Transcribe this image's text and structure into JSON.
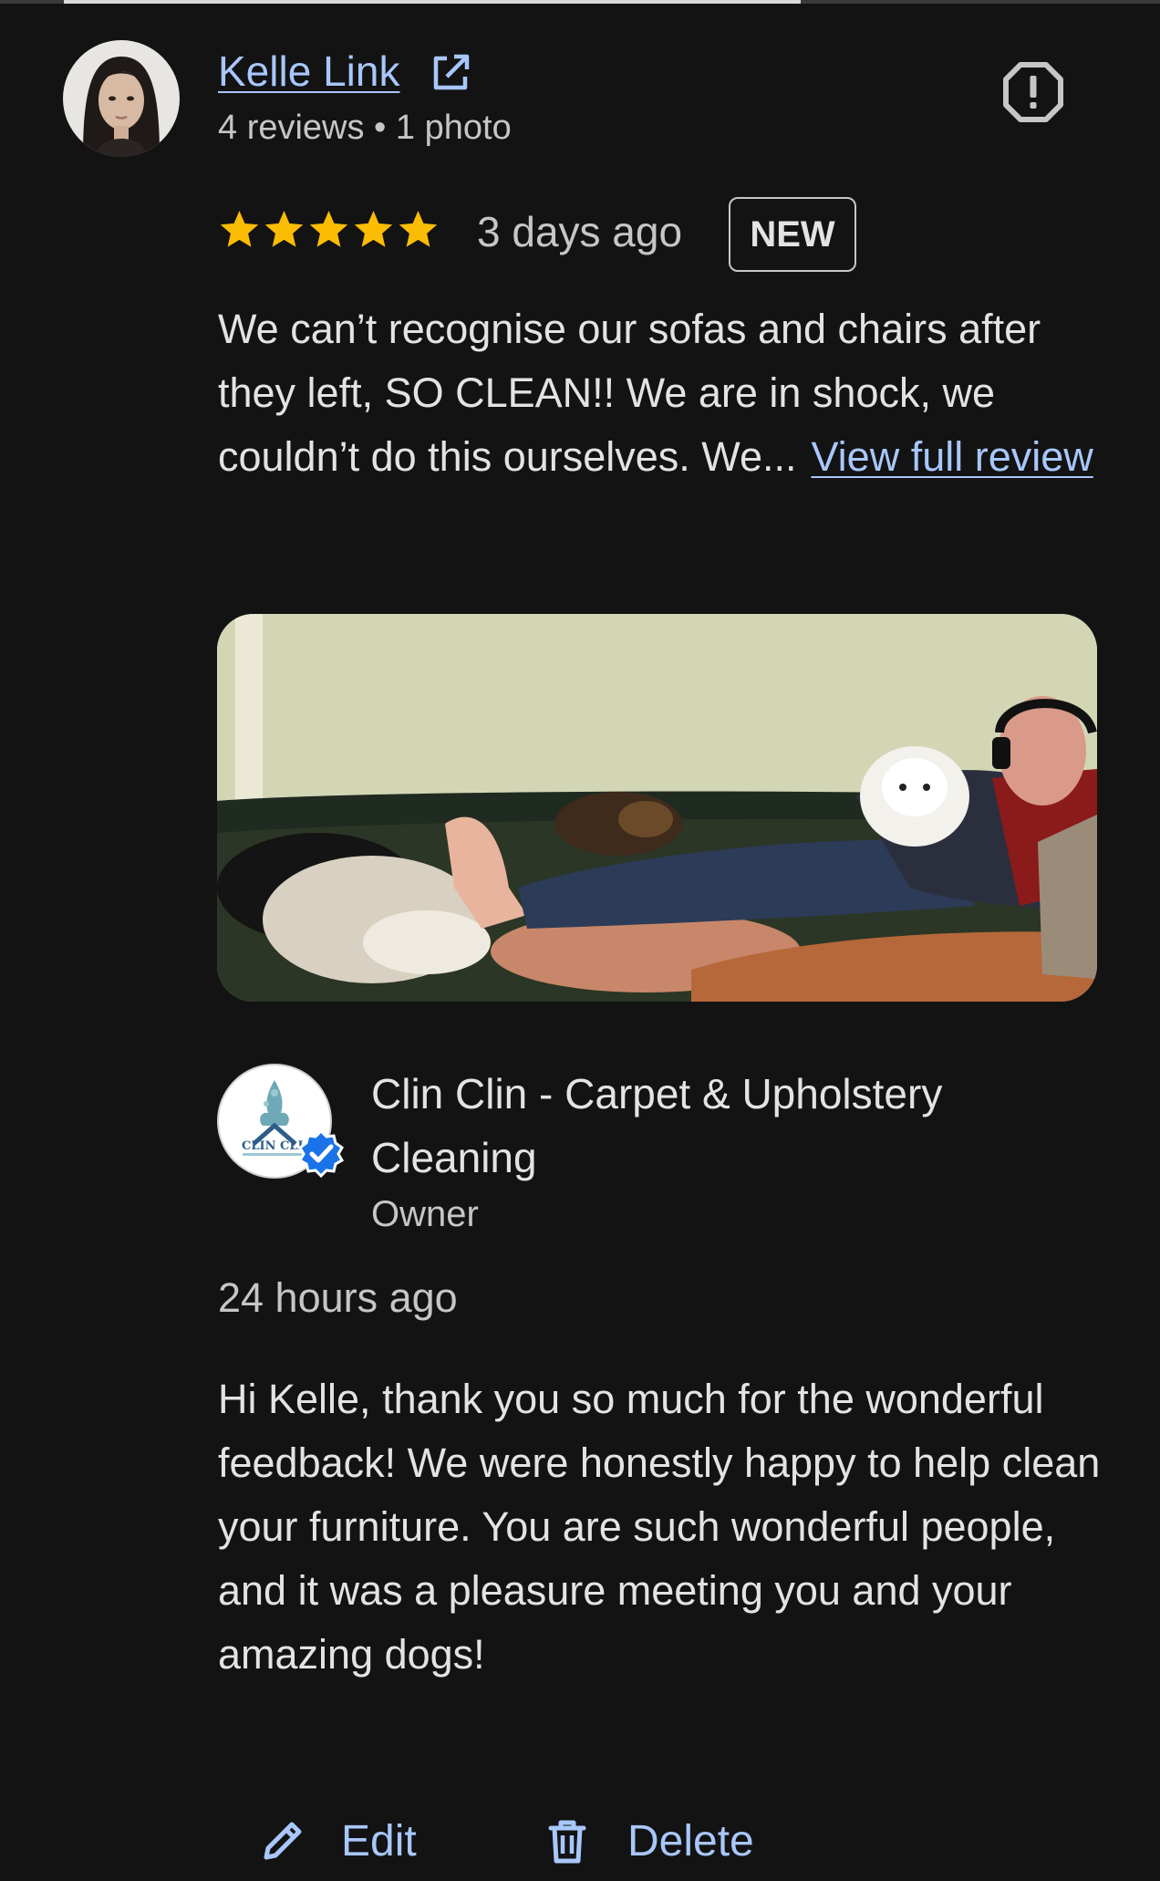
{
  "review": {
    "reviewer_name": "Kelle Link",
    "reviewer_meta": "4 reviews • 1 photo",
    "rating": 5,
    "time": "3 days ago",
    "badge": "NEW",
    "text": "We can’t recognise our sofas and chairs after they left, SO CLEAN!! We are in shock, we couldn’t do this ourselves. We...",
    "view_full_label": "View full review"
  },
  "owner_response": {
    "name": "Clin Clin - Carpet & Upholstery Cleaning",
    "role": "Owner",
    "logo_text": "CLIN CLI",
    "time": "24 hours ago",
    "text": "Hi Kelle, thank you so much for the wonderful feedback! We were honestly happy to help clean your furniture. You are such wonderful people, and it was a pleasure meeting you and your amazing dogs!"
  },
  "actions": {
    "edit_label": "Edit",
    "delete_label": "Delete"
  },
  "icons": {
    "external": "external-link-icon",
    "report": "report-icon",
    "star": "star-icon",
    "verified": "verified-icon",
    "edit": "pencil-icon",
    "delete": "trash-icon"
  },
  "colors": {
    "background": "#131314",
    "link": "#a8c7fa",
    "star": "#fbbc04",
    "verified": "#1a73e8"
  }
}
